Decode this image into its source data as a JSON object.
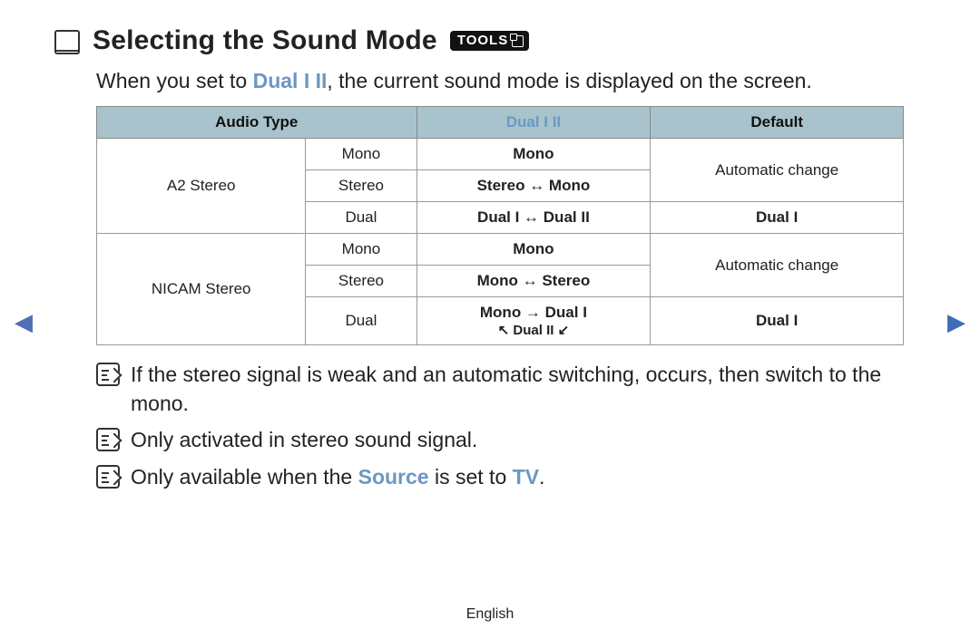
{
  "heading": {
    "title": "Selecting the Sound Mode",
    "tools_badge": "TOOLS"
  },
  "intro": {
    "pre": "When you set to ",
    "accent": "Dual I II",
    "post": ", the current sound mode is displayed on the screen."
  },
  "table": {
    "headers": {
      "audio_type": "Audio Type",
      "dual": "Dual I II",
      "default": "Default"
    },
    "groups": [
      {
        "name": "A2 Stereo",
        "rows": [
          {
            "sub": "Mono",
            "dual": "Mono",
            "default": "Automatic change",
            "default_rowspan": 2
          },
          {
            "sub": "Stereo",
            "dual": "Stereo ↔ Mono"
          },
          {
            "sub": "Dual",
            "dual": "Dual I ↔ Dual II",
            "default": "Dual I"
          }
        ]
      },
      {
        "name": "NICAM Stereo",
        "rows": [
          {
            "sub": "Mono",
            "dual": "Mono",
            "default": "Automatic change",
            "default_rowspan": 2
          },
          {
            "sub": "Stereo",
            "dual": "Mono ↔ Stereo"
          },
          {
            "sub": "Dual",
            "dual": "Mono → Dual I",
            "dual_line2": "↖ Dual II ↙",
            "default": "Dual I"
          }
        ]
      }
    ]
  },
  "notes": [
    {
      "text": "If the stereo signal is weak and an automatic switching, occurs, then switch to the mono."
    },
    {
      "text": "Only activated in stereo sound signal."
    },
    {
      "pre": "Only available when the ",
      "accent1": "Source",
      "mid": " is set to ",
      "accent2": "TV",
      "post": "."
    }
  ],
  "footer": {
    "language": "English"
  },
  "nav": {
    "left": "◀",
    "right": "▶"
  }
}
